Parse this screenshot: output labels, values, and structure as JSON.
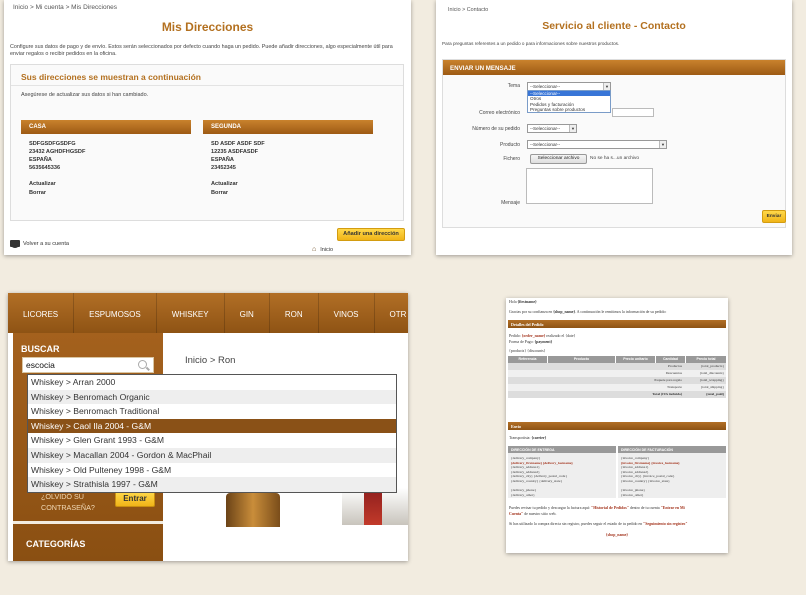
{
  "panel1": {
    "breadcrumb": "Inicio  >  Mi cuenta  >  Mis Direcciones",
    "title": "Mis Direcciones",
    "intro": "Configure sus datos de pago y de envío. Estos serán seleccionados por defecto cuando haga un pedido. Puede añadir direcciones, algo especialmente útil para enviar regalos o recibir pedidos en la oficina.",
    "box_title": "Sus direcciones se muestran a continuación",
    "note": "Asegúrese de actualizar sus datos si han cambiado.",
    "addresses": [
      {
        "label": "CASA",
        "lines": [
          "SDFGSDFGSDFG",
          "23432 AGHDFHGSDF",
          "ESPAÑA",
          "5635645336"
        ],
        "update": "Actualizar",
        "delete": "Borrar"
      },
      {
        "label": "SEGUNDA",
        "lines": [
          "SD ASDF ASDF SDF",
          "12235 ASDFASDF",
          "ESPAÑA",
          "23452345"
        ],
        "update": "Actualizar",
        "delete": "Borrar"
      }
    ],
    "back_link": "Volver a su cuenta",
    "add_button": "Añadir una dirección",
    "home_link": "Inicio"
  },
  "panel2": {
    "breadcrumb": "Inicio  >  Contacto",
    "title": "Servicio al cliente - Contacto",
    "intro": "Para preguntas referentes a un pedido o para informaciones sobre nuestros productos.",
    "form_head": "ENVIAR UN MENSAJE",
    "labels": {
      "tema": "Tema",
      "email": "Correo electrónico",
      "order": "Número de su pedido",
      "product": "Producto",
      "file": "Fichero",
      "message": "Mensaje"
    },
    "tema_selected": "--Seleccionar--",
    "tema_options": [
      "--Seleccionar--",
      "Otros",
      "Pedidos y facturación",
      "Preguntas sobre productos"
    ],
    "order_selected": "--Seleccionar--",
    "product_selected": "--Seleccionar--",
    "file_button": "Seleccionar archivo",
    "file_status": "No se ha s...un archivo",
    "send_button": "Enviar"
  },
  "panel3": {
    "nav": [
      "LICORES",
      "ESPUMOSOS",
      "WHISKEY",
      "GIN",
      "RON",
      "VINOS",
      "OTR"
    ],
    "search_title": "BUSCAR",
    "search_value": "escocia",
    "breadcrumb": "Inicio  >  Ron",
    "suggestions": [
      "Whiskey > Arran 2000",
      "Whiskey > Benromach Organic",
      "Whiskey > Benromach Traditional",
      "Whiskey > Caol Ila 2004 - G&M",
      "Whiskey > Glen Grant 1993 - G&M",
      "Whiskey > Macallan 2004 - Gordon & MacPhail",
      "Whiskey > Old Pulteney 1998 - G&M",
      "Whiskey > Strathisla 1997 - G&M"
    ],
    "highlighted_index": 3,
    "forgot_1": "¿OLVIDÓ SU",
    "forgot_2": "CONTRASEÑA?",
    "enter_button": "Entrar",
    "categories": "CATEGORÍAS"
  },
  "panel4": {
    "greeting_pre": "Hola ",
    "greeting_var": "{firstname}",
    "thanks_pre": "Gracias por su confianza en ",
    "thanks_var": "{shop_name}",
    "thanks_post": ". A continuación le remitimos la información de su pedido:",
    "bar_details": "Detalles del Pedido",
    "order_line_pre": "Pedido: ",
    "order_line_var": "{order_name}",
    "order_line_post": " realizado el {date}",
    "payment_pre": "Forma de Pago: ",
    "payment_var": "{payment}",
    "vars_line": "{products} {discounts}",
    "cols": [
      "Referencia",
      "Producto",
      "Precio unitario",
      "Cantidad",
      "Precio total"
    ],
    "rows": [
      {
        "label": "Productos",
        "value": "{total_products}"
      },
      {
        "label": "Descuentos",
        "value": "{total_discounts}"
      },
      {
        "label": "Paquete para regalo",
        "value": "{total_wrapping}"
      },
      {
        "label": "Transporte",
        "value": "{total_shipping}"
      },
      {
        "label": "Total (IVA incluido)",
        "value": "{total_paid}"
      }
    ],
    "bar_transport": "Envío",
    "carrier_pre": "Transportista: ",
    "carrier_var": "{carrier}",
    "delivery_head": "DIRECCIÓN DE ENTREGA",
    "delivery_lines": [
      "{delivery_company}",
      "{delivery_firstname} {delivery_lastname}",
      "{delivery_address1}",
      "{delivery_address2}",
      "{delivery_city} {delivery_postal_code}",
      "{delivery_country} {delivery_state}",
      "",
      "{delivery_phone}",
      "{delivery_other}"
    ],
    "invoice_head": "DIRECCIÓN DE FACTURACIÓN",
    "invoice_lines": [
      "{invoice_company}",
      "{invoice_firstname} {invoice_lastname}",
      "{invoice_address1}",
      "{invoice_address2}",
      "{invoice_city} {invoice_postal_code}",
      "{invoice_country} {invoice_state}",
      "",
      "{invoice_phone}",
      "{invoice_other}"
    ],
    "download_pre": "Puedes revisar tu pedido y descargar la factura aquí: ",
    "download_link": "\"Historial de Pedidos\"",
    "download_mid": " dentro de tu cuenta ",
    "download_link2": "\"Entrar en Mi",
    "download_link3": "Cuenta\"",
    "download_post": " de nuestro sitio web.",
    "guest_pre": "Si has utilizado la compra directa sin registro, puedes seguir el estado de tu pedido en ",
    "guest_link": "\"Seguimiento sin registro\"",
    "footer_var": "{shop_name}"
  }
}
